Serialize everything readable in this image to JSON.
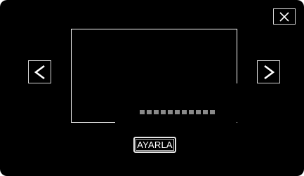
{
  "screen": {
    "background_color": "#000000",
    "icon_color": "#ffffff"
  },
  "controls": {
    "close_icon": "close-icon",
    "prev_icon": "chevron-left-icon",
    "next_icon": "chevron-right-icon",
    "set_button_label": "AYARLA"
  },
  "progress": {
    "segments": 11,
    "color": "#8a8a8a"
  }
}
